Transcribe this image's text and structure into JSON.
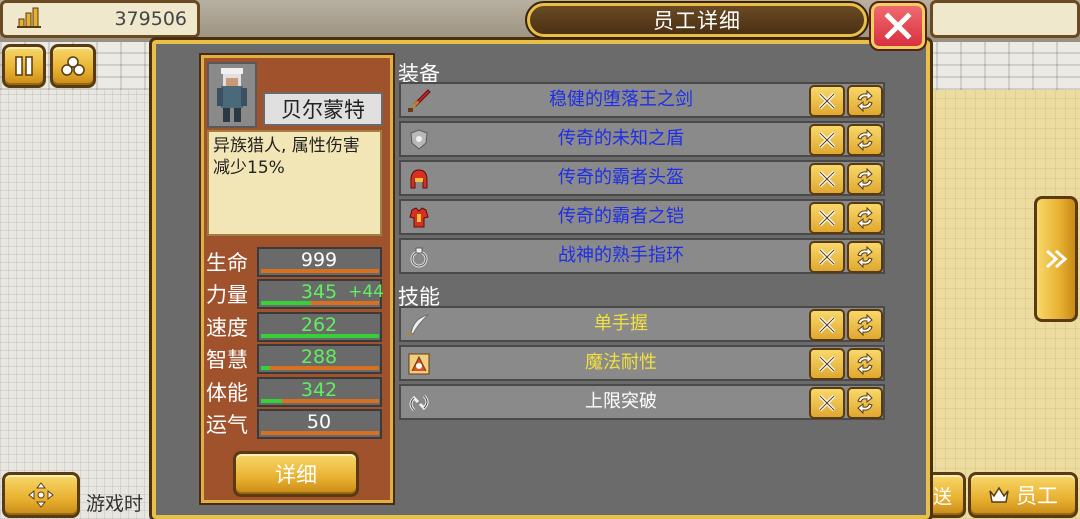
{
  "hud": {
    "money_value": "379506",
    "pause_icon": "pause-icon",
    "bottom_left_text": "游戏时",
    "bottom_right_partial": "送",
    "staff_button_label": "员工"
  },
  "dialog": {
    "title": "员工详细",
    "close_icon": "close-icon"
  },
  "employee": {
    "name": "贝尔蒙特",
    "description": "异族猎人, 属性伤害减少15%",
    "stats": [
      {
        "label": "生命",
        "value": "999",
        "bonus": "",
        "fill": 0.0,
        "color": "#ffffff"
      },
      {
        "label": "力量",
        "value": "345",
        "bonus": "+44",
        "fill": 0.42,
        "color": "#5ef05e"
      },
      {
        "label": "速度",
        "value": "262",
        "bonus": "",
        "fill": 1.0,
        "color": "#5ef05e"
      },
      {
        "label": "智慧",
        "value": "288",
        "bonus": "",
        "fill": 0.08,
        "color": "#5ef05e"
      },
      {
        "label": "体能",
        "value": "342",
        "bonus": "",
        "fill": 0.18,
        "color": "#5ef05e"
      },
      {
        "label": "运气",
        "value": "50",
        "bonus": "",
        "fill": 0.0,
        "color": "#ffffff"
      }
    ],
    "detail_button_label": "详细"
  },
  "equipment": {
    "heading": "装备",
    "items": [
      {
        "icon": "sword-icon",
        "label": "稳健的堕落王之剑"
      },
      {
        "icon": "shield-icon",
        "label": "传奇的未知之盾"
      },
      {
        "icon": "helmet-icon",
        "label": "传奇的霸者头盔"
      },
      {
        "icon": "armor-icon",
        "label": "传奇的霸者之铠"
      },
      {
        "icon": "ring-icon",
        "label": "战神的熟手指环"
      }
    ]
  },
  "skills": {
    "heading": "技能",
    "items": [
      {
        "icon": "feather-icon",
        "label": "单手握",
        "color": "#f0e040"
      },
      {
        "icon": "magic-resist-icon",
        "label": "魔法耐性",
        "color": "#f0e040"
      },
      {
        "icon": "limit-break-icon",
        "label": "上限突破",
        "color": "#ffffff"
      }
    ]
  },
  "colors": {
    "equipment_text": "#1e2ee8",
    "skill_text": "#f0e040",
    "dialog_bg": "#6b6b6b",
    "card_bg": "#a0522d",
    "gold": "#e8b030"
  }
}
